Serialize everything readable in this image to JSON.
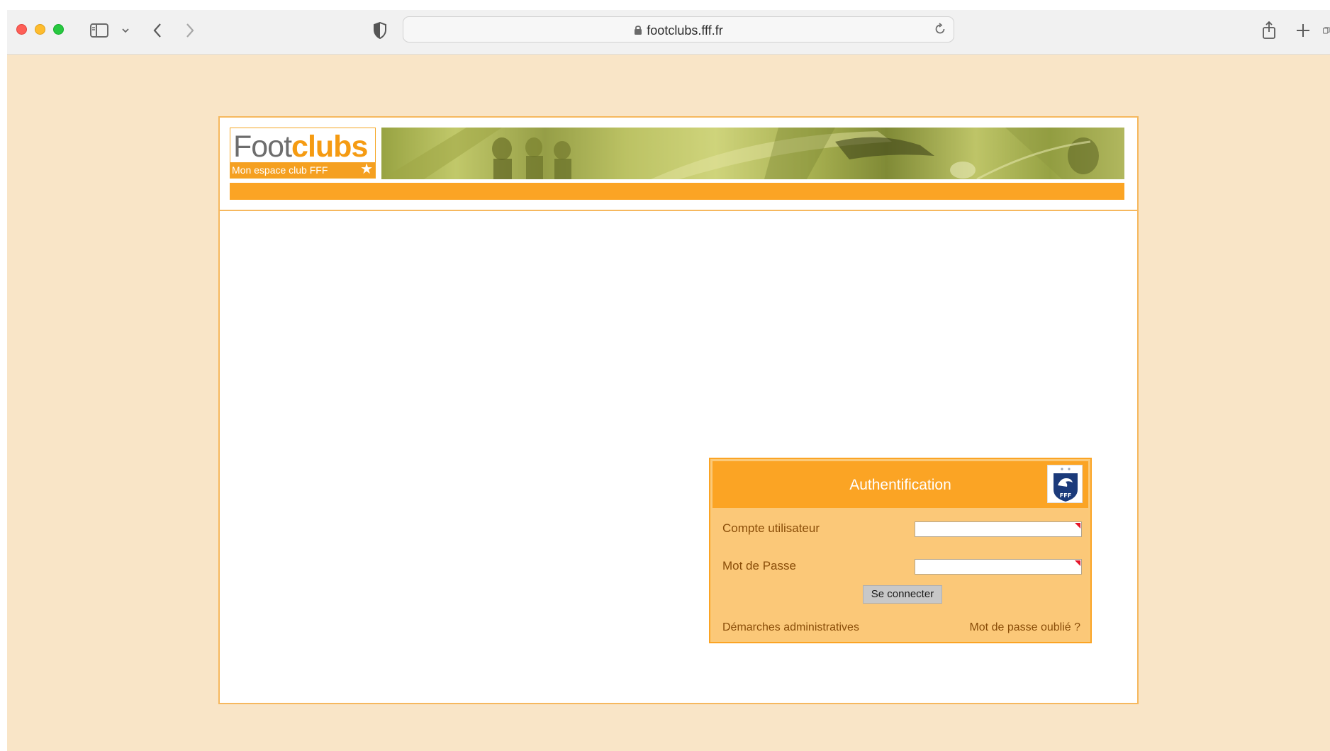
{
  "browser": {
    "url": "footclubs.fff.fr",
    "icons": [
      "sidebar-icon",
      "chevron-down-icon",
      "back-icon",
      "forward-icon",
      "shield-icon",
      "lock-icon",
      "reload-icon",
      "share-icon",
      "new-tab-icon",
      "tab-overview-icon"
    ]
  },
  "header": {
    "logo_foot": "Foot",
    "logo_clubs": "clubs",
    "logo_subtitle": "Mon espace club FFF"
  },
  "auth": {
    "title": "Authentification",
    "user_label": "Compte utilisateur",
    "password_label": "Mot de Passe",
    "user_value": "",
    "password_value": "",
    "connect_button": "Se connecter",
    "admin_link": "Démarches administratives",
    "forgot_link": "Mot de passe oublié ?",
    "fff_logo_text": "FFF"
  },
  "colors": {
    "page_background": "#f9e5c7",
    "accent_orange": "#fba424",
    "form_background": "#fbc878",
    "label_text": "#8a4d08"
  }
}
